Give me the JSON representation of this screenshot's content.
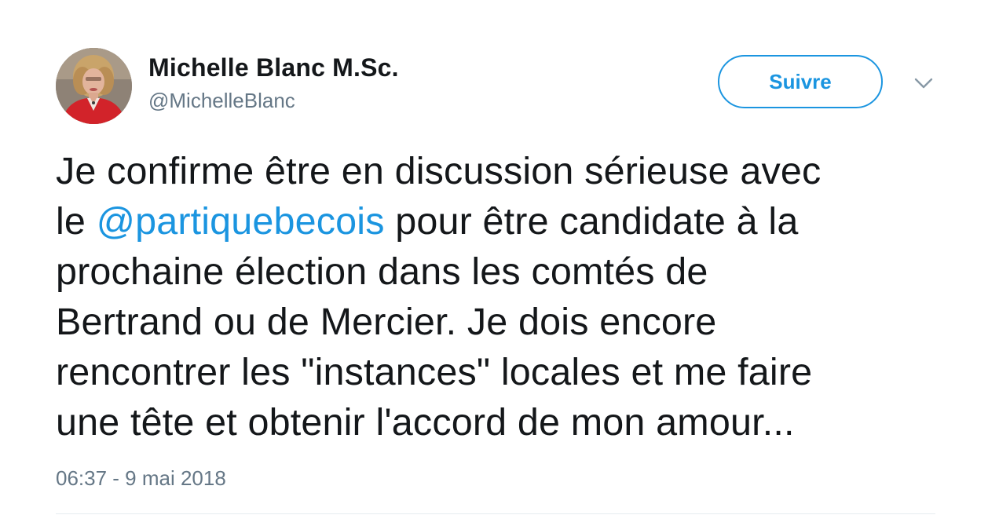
{
  "author": {
    "display_name": "Michelle Blanc M.Sc.",
    "handle": "@MichelleBlanc",
    "avatar_icon": "profile-photo"
  },
  "actions": {
    "follow_label": "Suivre",
    "menu_icon": "chevron-down-icon"
  },
  "tweet": {
    "lines": [
      {
        "text": "Je confirme être en discussion sérieuse avec"
      },
      {
        "before": "le ",
        "mention": "@partiquebecois",
        "after": " pour être candidate à la"
      },
      {
        "text": "prochaine élection dans les comtés de"
      },
      {
        "text": "Bertrand ou de Mercier. Je dois encore"
      },
      {
        "text": "rencontrer les \"instances\" locales et me faire"
      },
      {
        "text": "une tête et obtenir l'accord de mon amour..."
      }
    ],
    "timestamp": "06:37 - 9 mai 2018"
  },
  "colors": {
    "accent": "#1b95e0",
    "text": "#14171a",
    "secondary": "#657786"
  }
}
